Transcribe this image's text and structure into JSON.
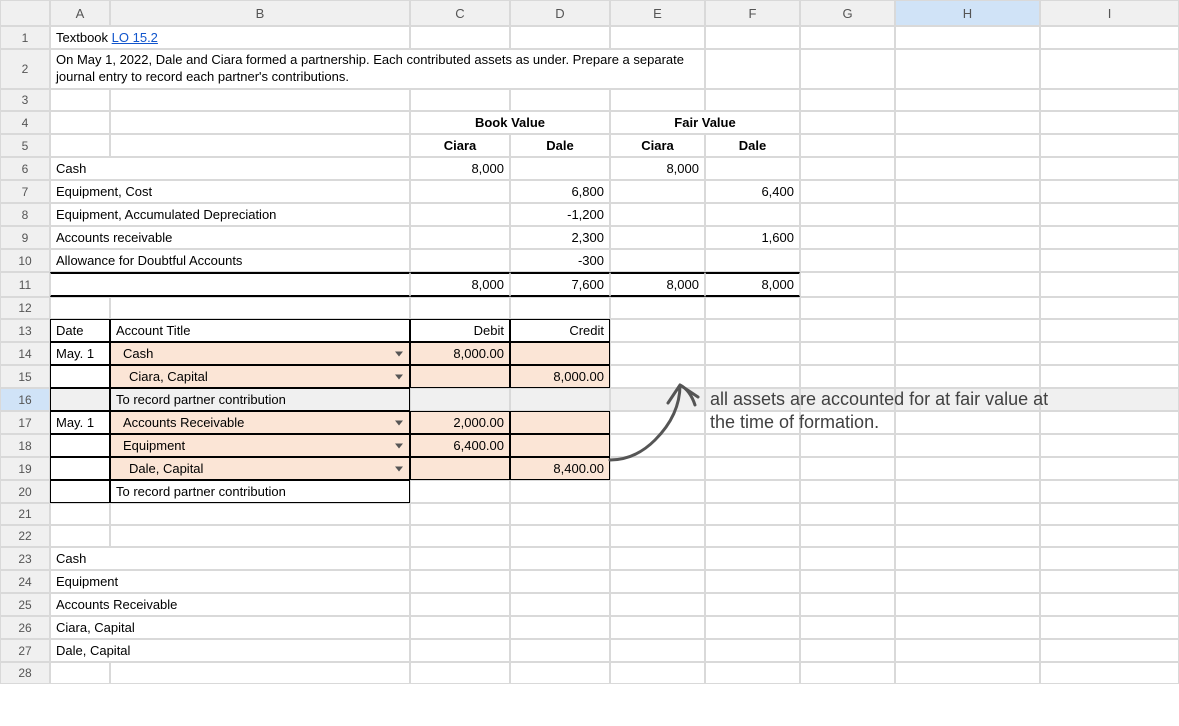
{
  "columns": [
    "A",
    "B",
    "C",
    "D",
    "E",
    "F",
    "G",
    "H",
    "I"
  ],
  "rows": [
    "1",
    "2",
    "3",
    "4",
    "5",
    "6",
    "7",
    "8",
    "9",
    "10",
    "11",
    "12",
    "13",
    "14",
    "15",
    "16",
    "17",
    "18",
    "19",
    "20",
    "21",
    "22",
    "23",
    "24",
    "25",
    "26",
    "27",
    "28"
  ],
  "r1": {
    "A_prefix": "Textbook ",
    "A_link": "LO 15.2"
  },
  "r2": {
    "text": "On May 1, 2022, Dale and Ciara formed a partnership. Each contributed assets as under.  Prepare a separate journal entry to record each partner's contributions."
  },
  "r4": {
    "CD": "Book Value",
    "EF": "Fair Value"
  },
  "r5": {
    "C": "Ciara",
    "D": "Dale",
    "E": "Ciara",
    "F": "Dale"
  },
  "r6": {
    "A": "Cash",
    "C": "8,000",
    "E": "8,000"
  },
  "r7": {
    "A": "Equipment, Cost",
    "D": "6,800",
    "F": "6,400"
  },
  "r8": {
    "A": "Equipment, Accumulated Depreciation",
    "D": "-1,200"
  },
  "r9": {
    "A": "Accounts receivable",
    "D": "2,300",
    "F": "1,600"
  },
  "r10": {
    "A": "Allowance for Doubtful Accounts",
    "D": "-300"
  },
  "r11": {
    "C": "8,000",
    "D": "7,600",
    "E": "8,000",
    "F": "8,000"
  },
  "r13": {
    "A": "Date",
    "B": "Account Title",
    "C": "Debit",
    "D": "Credit"
  },
  "r14": {
    "A": "May. 1",
    "B": "Cash",
    "C": "8,000.00"
  },
  "r15": {
    "B": "Ciara, Capital",
    "D": "8,000.00"
  },
  "r16": {
    "B": "To record partner contribution"
  },
  "r17": {
    "A": "May. 1",
    "B": "Accounts Receivable",
    "C": "2,000.00"
  },
  "r18": {
    "B": "Equipment",
    "C": "6,400.00"
  },
  "r19": {
    "B": "Dale, Capital",
    "D": "8,400.00"
  },
  "r20": {
    "B": "To record partner contribution"
  },
  "r23": {
    "A": "Cash"
  },
  "r24": {
    "A": "Equipment"
  },
  "r25": {
    "A": "Accounts Receivable"
  },
  "r26": {
    "A": "Ciara, Capital"
  },
  "r27": {
    "A": "Dale, Capital"
  },
  "annotation": "all assets are accounted for at fair value at the time of formation."
}
